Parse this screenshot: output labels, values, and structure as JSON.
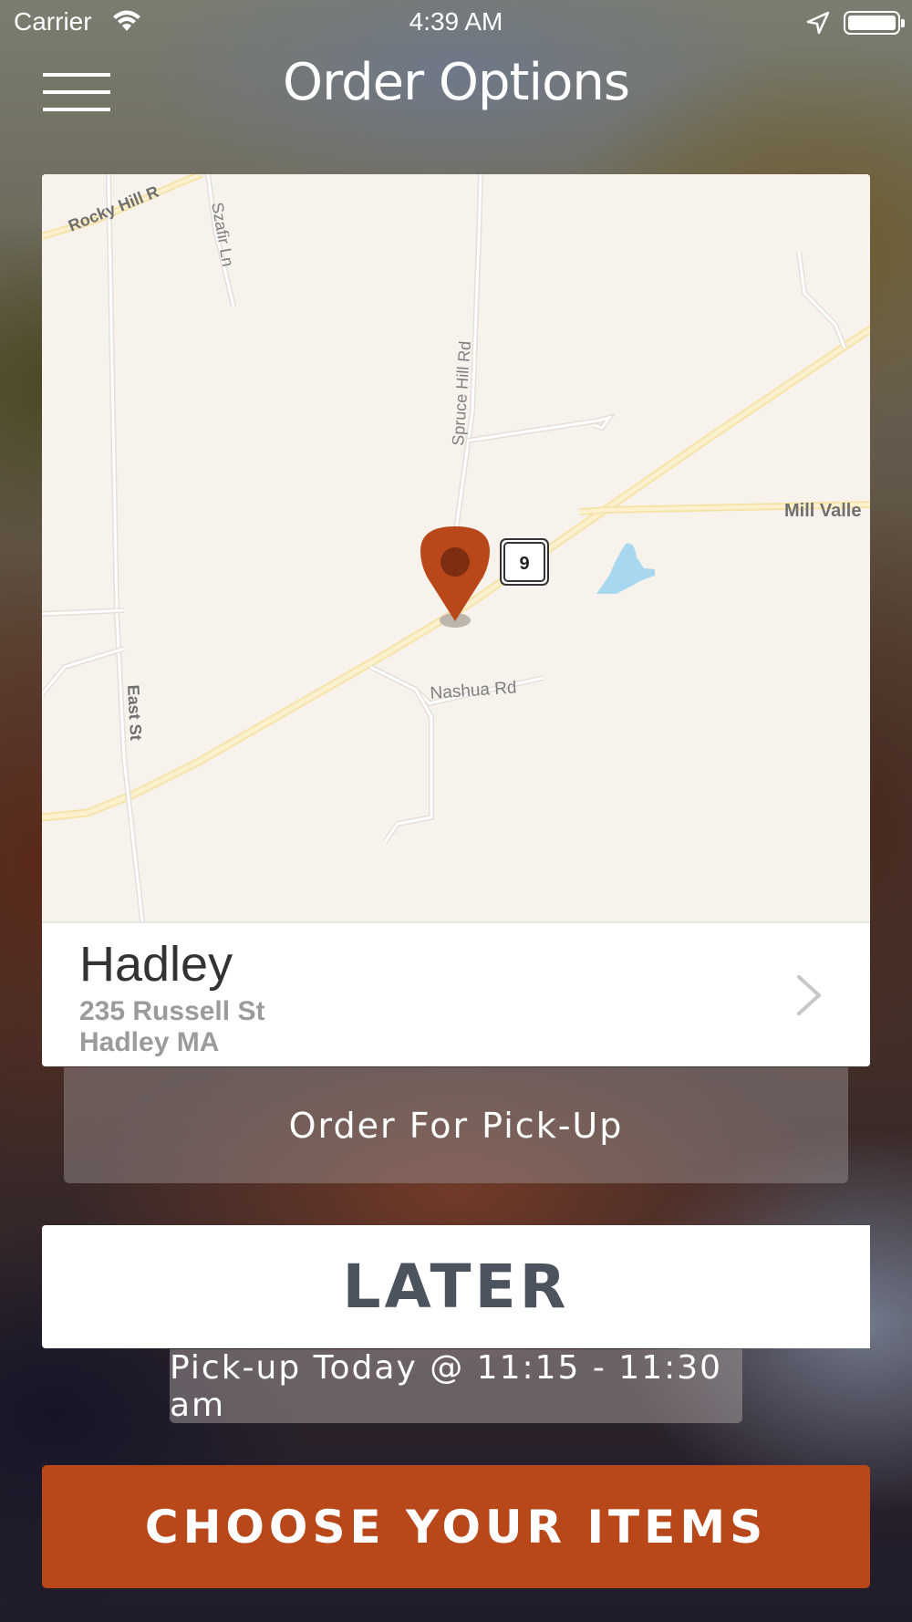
{
  "status_bar": {
    "carrier": "Carrier",
    "time": "4:39 AM",
    "icons": [
      "wifi-icon",
      "location-arrow-icon",
      "battery-icon"
    ]
  },
  "header": {
    "title": "Order Options",
    "menu_icon": "hamburger-menu-icon"
  },
  "map": {
    "roads": [
      "Rocky Hill R",
      "Szafir Ln",
      "Spruce Hill Rd",
      "Mill Valle",
      "Nashua Rd",
      "East St"
    ],
    "route_shield": "9",
    "pin_icon": "map-pin-icon",
    "pin_color": "#b8471a"
  },
  "location": {
    "name": "Hadley",
    "street": "235 Russell St",
    "city": "Hadley MA",
    "chevron_icon": "chevron-right-icon"
  },
  "order_mode": {
    "label": "Order For Pick-Up"
  },
  "timing": {
    "selected": "LATER",
    "pickup_label": "Pick-up Today @ 11:15 - 11:30 am"
  },
  "cta": {
    "label": "CHOOSE YOUR ITEMS",
    "color": "#b8471a"
  }
}
